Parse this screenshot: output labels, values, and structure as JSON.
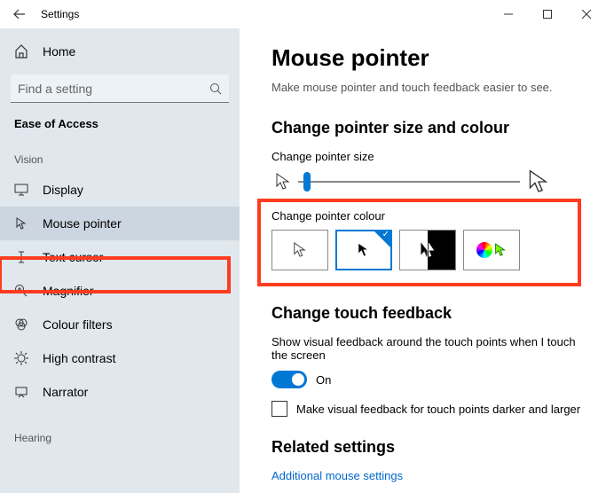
{
  "titlebar": {
    "title": "Settings"
  },
  "sidebar": {
    "home": "Home",
    "search_placeholder": "Find a setting",
    "category": "Ease of Access",
    "group_vision": "Vision",
    "group_hearing": "Hearing",
    "items": [
      {
        "label": "Display"
      },
      {
        "label": "Mouse pointer"
      },
      {
        "label": "Text cursor"
      },
      {
        "label": "Magnifier"
      },
      {
        "label": "Colour filters"
      },
      {
        "label": "High contrast"
      },
      {
        "label": "Narrator"
      }
    ]
  },
  "main": {
    "title": "Mouse pointer",
    "desc": "Make mouse pointer and touch feedback easier to see.",
    "section_size": "Change pointer size and colour",
    "size_label": "Change pointer size",
    "colour_label": "Change pointer colour",
    "touch_section": "Change touch feedback",
    "touch_text": "Show visual feedback around the touch points when I touch the screen",
    "toggle_state": "On",
    "checkbox_label": "Make visual feedback for touch points darker and larger",
    "related": "Related settings",
    "link": "Additional mouse settings"
  }
}
